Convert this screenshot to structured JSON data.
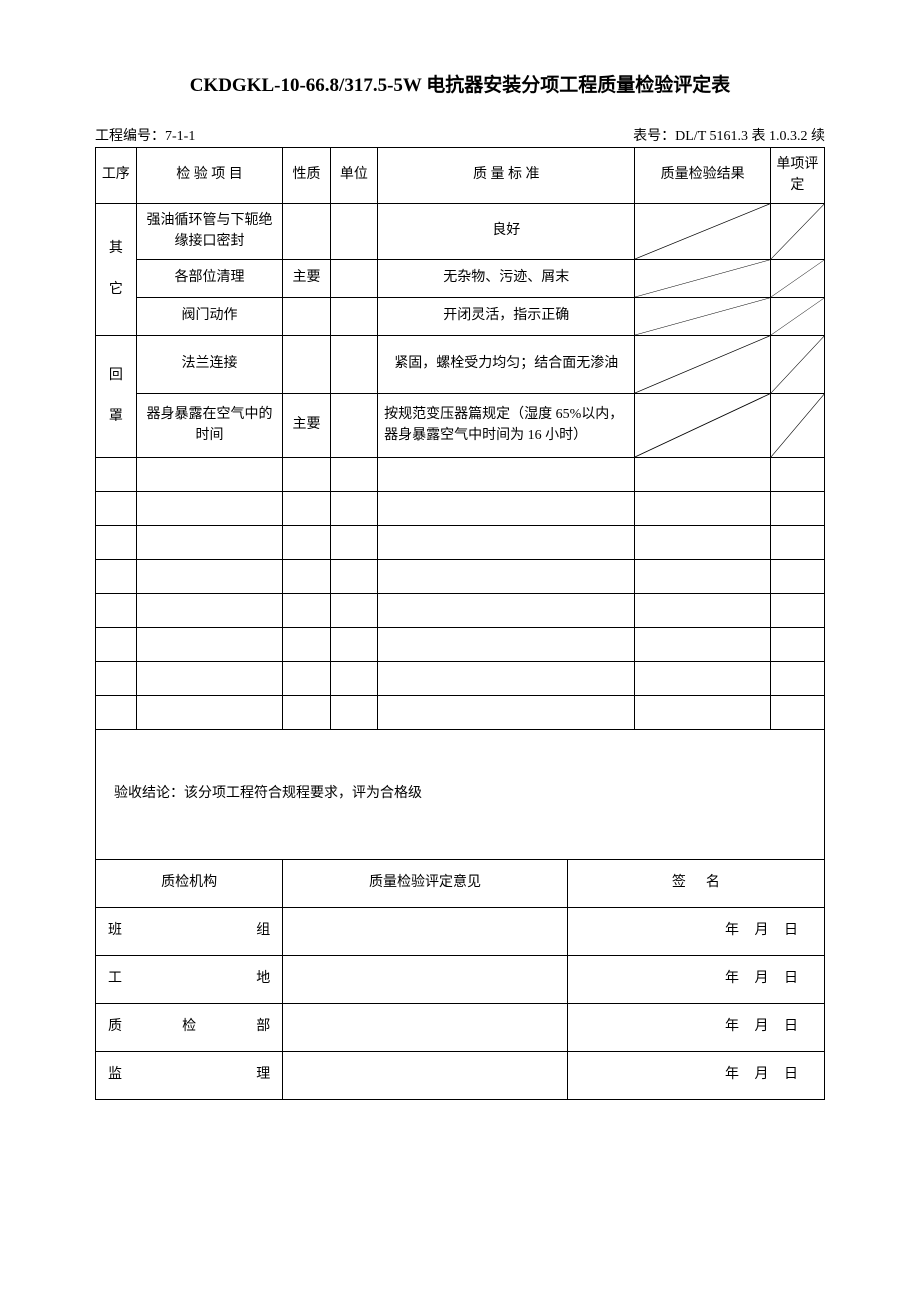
{
  "title": "CKDGKL-10-66.8/317.5-5W 电抗器安装分项工程质量检验评定表",
  "meta": {
    "left": "工程编号：7-1-1",
    "mid": "",
    "right": "表号：DL/T 5161.3  表 1.0.3.2 续"
  },
  "header": {
    "c1": "工序",
    "c2": "检 验 项 目",
    "c3": "性质",
    "c4": "单位",
    "c5": "质 量 标 准",
    "c6": "质量检验结果",
    "c7": "单项评定"
  },
  "sections": {
    "s1_name": "其\n\n它",
    "s2_name": "回\n\n罩"
  },
  "rows": [
    {
      "item": "强油循环管与下轭绝缘接口密封",
      "nature": "",
      "unit": "",
      "std": "良好"
    },
    {
      "item": "各部位清理",
      "nature": "主要",
      "unit": "",
      "std": "无杂物、污迹、屑末"
    },
    {
      "item": "阀门动作",
      "nature": "",
      "unit": "",
      "std": "开闭灵活，指示正确"
    },
    {
      "item": "法兰连接",
      "nature": "",
      "unit": "",
      "std": "紧固，螺栓受力均匀；结合面无渗油"
    },
    {
      "item": "器身暴露在空气中的时间",
      "nature": "主要",
      "unit": "",
      "std": "按规范变压器篇规定（湿度 65%以内，器身暴露空气中时间为 16 小时）"
    }
  ],
  "conclusion": "验收结论：该分项工程符合规程要求，评为合格级",
  "footer": {
    "org": "质检机构",
    "opinion": "质量检验评定意见",
    "sign_hdr": "签",
    "sign_hdr2": "名",
    "r1": "班    组",
    "r2": "工    地",
    "r3": "质 检 部",
    "r4": "监    理",
    "date": "年   月   日"
  }
}
